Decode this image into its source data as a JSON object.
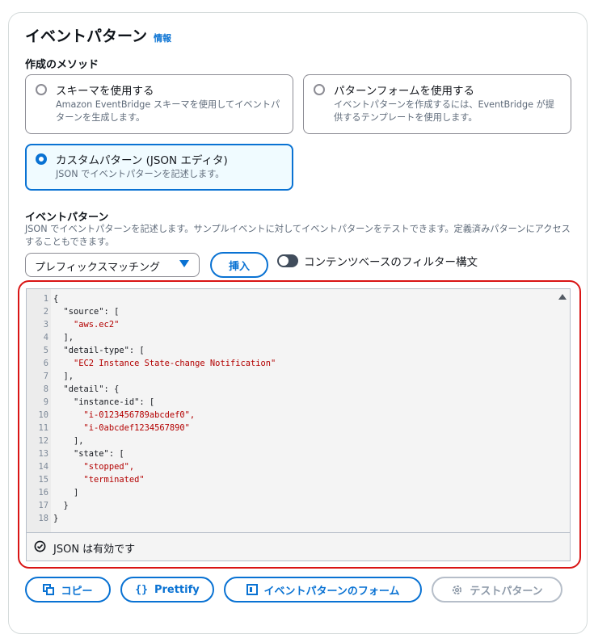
{
  "header": {
    "title": "イベントパターン",
    "info_link": "情報"
  },
  "creation_method": {
    "label": "作成のメソッド",
    "options": [
      {
        "title": "スキーマを使用する",
        "description": "Amazon EventBridge スキーマを使用してイベントパターンを生成します。",
        "selected": false
      },
      {
        "title": "パターンフォームを使用する",
        "description": "イベントパターンを作成するには、EventBridge が提供するテンプレートを使用します。",
        "selected": false
      },
      {
        "title": "カスタムパターン (JSON エディタ)",
        "description": "JSON でイベントパターンを記述します。",
        "selected": true
      }
    ]
  },
  "event_pattern": {
    "label": "イベントパターン",
    "description": "JSON でイベントパターンを記述します。サンプルイベントに対してイベントパターンをテストできます。定義済みパターンにアクセスすることもできます。",
    "select_value": "プレフィックスマッチング",
    "insert_button": "挿入",
    "toggle_label": "コンテンツベースのフィルター構文",
    "toggle_on": false
  },
  "editor": {
    "lines": [
      "{",
      "  \"source\": [",
      "    \"aws.ec2\"",
      "  ],",
      "  \"detail-type\": [",
      "    \"EC2 Instance State-change Notification\"",
      "  ],",
      "  \"detail\": {",
      "    \"instance-id\": [",
      "      \"i-0123456789abcdef0\",",
      "      \"i-0abcdef1234567890\"",
      "    ],",
      "    \"state\": [",
      "      \"stopped\",",
      "      \"terminated\"",
      "    ]",
      "  }",
      "}"
    ],
    "line_numbers": [
      "1",
      "2",
      "3",
      "4",
      "5",
      "6",
      "7",
      "8",
      "9",
      "10",
      "11",
      "12",
      "13",
      "14",
      "15",
      "16",
      "17",
      "18"
    ],
    "status": "JSON は有効です"
  },
  "actions": {
    "copy": "コピー",
    "prettify": "Prettify",
    "pattern_form": "イベントパターンのフォーム",
    "test_pattern": "テストパターン"
  },
  "colors": {
    "accent": "#0972d3",
    "highlight": "#d91515",
    "string": "#b30000",
    "disabled": "#8d99a8"
  }
}
